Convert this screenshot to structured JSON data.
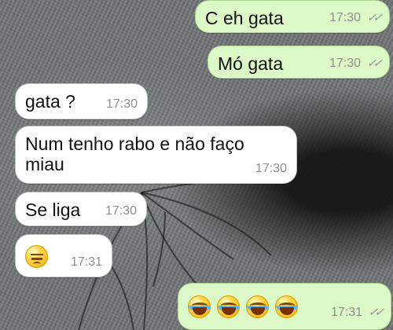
{
  "messages": [
    {
      "text": "C eh gata",
      "time": "17:30",
      "status": "✓✓",
      "direction": "out"
    },
    {
      "text": "Mó gata",
      "time": "17:30",
      "status": "✓✓",
      "direction": "out"
    },
    {
      "text": "gata ?",
      "time": "17:30",
      "direction": "in"
    },
    {
      "text": "Num tenho rabo e não faço\nmiau",
      "time": "17:30",
      "direction": "in"
    },
    {
      "text": "Se liga",
      "time": "17:30",
      "direction": "in"
    },
    {
      "emoji": [
        "unamused-face"
      ],
      "time": "17:31",
      "direction": "in"
    },
    {
      "emoji": [
        "face-with-tears-of-joy",
        "face-with-tears-of-joy",
        "face-with-tears-of-joy",
        "face-with-tears-of-joy"
      ],
      "time": "17:31",
      "status": "✓✓",
      "direction": "out"
    }
  ],
  "colors": {
    "incoming_bubble": "#ffffff",
    "outgoing_bubble": "#dcf8c6",
    "timestamp": "#8f8f8f",
    "wallpaper": "#6f7373"
  }
}
